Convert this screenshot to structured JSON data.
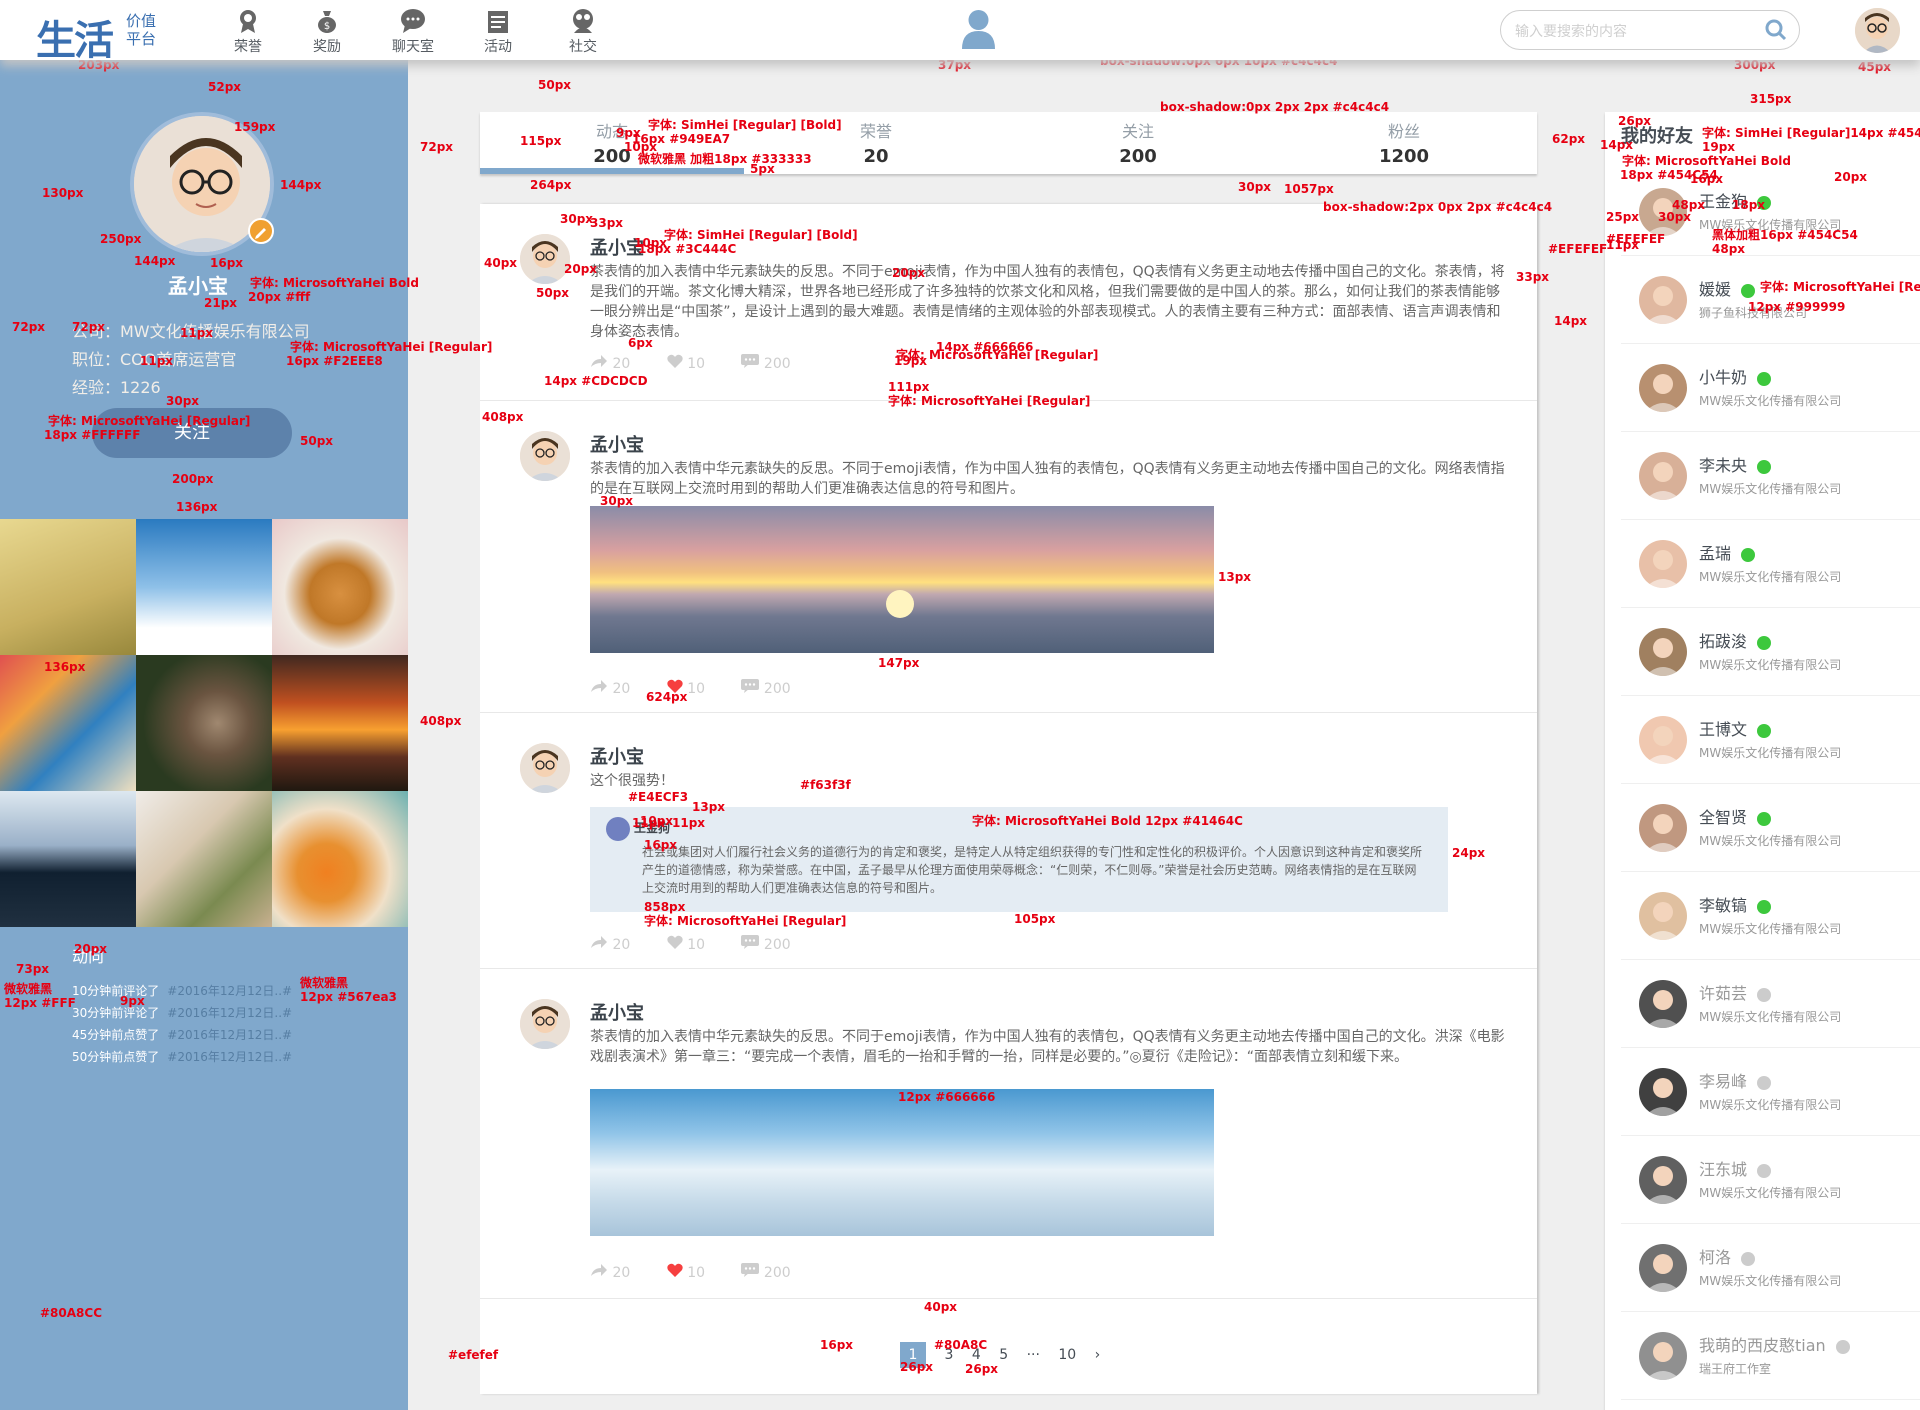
{
  "header": {
    "logo_big": "生活",
    "logo_small_1": "价值",
    "logo_small_2": "平台",
    "nav": [
      {
        "label": "荣誉",
        "icon": "medal-icon"
      },
      {
        "label": "奖励",
        "icon": "money-bag-icon"
      },
      {
        "label": "聊天室",
        "icon": "chat-icon"
      },
      {
        "label": "活动",
        "icon": "calendar-icon"
      },
      {
        "label": "社交",
        "icon": "social-icon"
      }
    ],
    "search_placeholder": "输入要搜索的内容"
  },
  "profile": {
    "name": "孟小宝",
    "company": "公司：MW文化传播娱乐有限公司",
    "position": "职位：COO首席运营官",
    "experience": "经验：1226",
    "follow_label": "关注"
  },
  "dynamics": {
    "title": "动向",
    "items": [
      {
        "text": "10分钟前评论了",
        "date": "#2016年12月12日..#"
      },
      {
        "text": "30分钟前评论了",
        "date": "#2016年12月12日..#"
      },
      {
        "text": "45分钟前点赞了",
        "date": "#2016年12月12日..#"
      },
      {
        "text": "50分钟前点赞了",
        "date": "#2016年12月12日..#"
      }
    ]
  },
  "stats": [
    {
      "label": "动态",
      "value": "200"
    },
    {
      "label": "荣誉",
      "value": "20"
    },
    {
      "label": "关注",
      "value": "200"
    },
    {
      "label": "粉丝",
      "value": "1200"
    }
  ],
  "posts": [
    {
      "name": "孟小宝",
      "text": "茶表情的加入表情中华元素缺失的反思。不同于emoji表情，作为中国人独有的表情包，QQ表情有义务更主动地去传播中国自己的文化。茶表情，将是我们的开端。茶文化博大精深，世界各地已经形成了许多独特的饮茶文化和风格，但我们需要做的是中国人的茶。那么，如何让我们的茶表情能够一眼分辨出是“中国茶”，是设计上遇到的最大难题。表情是情绪的主观体验的外部表现模式。人的表情主要有三种方式：面部表情、语言声调表情和身体姿态表情。",
      "share": "20",
      "like": "10",
      "comment": "200"
    },
    {
      "name": "孟小宝",
      "text": "茶表情的加入表情中华元素缺失的反思。不同于emoji表情，作为中国人独有的表情包，QQ表情有义务更主动地去传播中国自己的文化。网络表情指的是在互联网上交流时用到的帮助人们更准确表达信息的符号和图片。",
      "share": "20",
      "like": "10",
      "comment": "200"
    },
    {
      "name": "孟小宝",
      "text": "这个很强势！",
      "quote_name": "王金狗",
      "quote_text": "社会或集团对人们履行社会义务的道德行为的肯定和褒奖，是特定人从特定组织获得的专门性和定性化的积极评价。个人因意识到这种肯定和褒奖所产生的道德情感，称为荣誉感。在中国，孟子最早从伦理方面使用荣辱概念：“仁则荣，不仁则辱。”荣誉是社会历史范畴。网络表情指的是在互联网上交流时用到的帮助人们更准确表达信息的符号和图片。",
      "share": "20",
      "like": "10",
      "comment": "200"
    },
    {
      "name": "孟小宝",
      "text": "茶表情的加入表情中华元素缺失的反思。不同于emoji表情，作为中国人独有的表情包，QQ表情有义务更主动地去传播中国自己的文化。洪深《电影戏剧表演术》第一章三：“要完成一个表情，眉毛的一抬和手臂的一抬，同样是必要的。”◎夏衍《走险记》：“面部表情立刻和缓下来。",
      "share": "20",
      "like": "10",
      "comment": "200"
    }
  ],
  "pager": {
    "current": "1",
    "items": [
      "3",
      "4",
      "5",
      "···",
      "10"
    ],
    "next": "›"
  },
  "friends": {
    "title": "我的好友",
    "list": [
      {
        "name": "王金狗",
        "company": "MW娱乐文化传播有限公司",
        "online": true
      },
      {
        "name": "媛媛",
        "company": "狮子鱼科技有限公司",
        "online": true
      },
      {
        "name": "小牛奶",
        "company": "MW娱乐文化传播有限公司",
        "online": true
      },
      {
        "name": "李未央",
        "company": "MW娱乐文化传播有限公司",
        "online": true
      },
      {
        "name": "孟瑞",
        "company": "MW娱乐文化传播有限公司",
        "online": true
      },
      {
        "name": "拓跋浚",
        "company": "MW娱乐文化传播有限公司",
        "online": true
      },
      {
        "name": "王博文",
        "company": "MW娱乐文化传播有限公司",
        "online": true
      },
      {
        "name": "全智贤",
        "company": "MW娱乐文化传播有限公司",
        "online": true
      },
      {
        "name": "李敏镐",
        "company": "MW娱乐文化传播有限公司",
        "online": true
      },
      {
        "name": "许茹芸",
        "company": "MW娱乐文化传播有限公司",
        "online": false
      },
      {
        "name": "李易峰",
        "company": "MW娱乐文化传播有限公司",
        "online": false
      },
      {
        "name": "汪东城",
        "company": "MW娱乐文化传播有限公司",
        "online": false
      },
      {
        "name": "柯洛",
        "company": "MW娱乐文化传播有限公司",
        "online": false
      },
      {
        "name": "我萌的西皮憨tian",
        "company": "瑞王府工作室",
        "online": false
      }
    ]
  },
  "annotations": [
    "9px",
    "37px",
    "#E0E0E0",
    "33px",
    "11px",
    "53px",
    "2px",
    "11px",
    "30px",
    "203px",
    "字体: MicrosoftYaHei [Regular]",
    "14px #555B61",
    "#80a8cc",
    "11px",
    "41px",
    "37px",
    "12px",
    "40px",
    "字体: MicrosoftYaHei [Regular]",
    "14px #CFCFCF",
    "45px",
    "24px",
    "53px",
    "300px",
    "45px",
    "box-shadow:0px 6px 10px #c4c4c4",
    "50px",
    "315px",
    "box-shadow:0px 2px 2px #c4c4c4",
    "52px",
    "159px",
    "144px",
    "130px",
    "250px",
    "144px",
    "16px",
    "72px",
    "字体: MicrosoftYaHei Bold",
    "20px #fff",
    "21px",
    "11px",
    "字体: MicrosoftYaHei [Regular]",
    "16px #F2EEE8",
    "11px",
    "72px",
    "30px",
    "字体: MicrosoftYaHei [Regular]",
    "18px #FFFFFF",
    "50px",
    "200px",
    "408px",
    "136px",
    "136px",
    "408px",
    "73px",
    "20px",
    "微软雅黑",
    "12px #FFF",
    "微软雅黑",
    "12px #567ea3",
    "9px",
    "#80A8CC",
    "#efefef",
    "72px",
    "115px",
    "字体: SimHei [Regular] [Bold]",
    "16px #949EA7",
    "微软雅黑 加粗18px #333333",
    "10px",
    "9px",
    "5px",
    "264px",
    "1057px",
    "30px",
    "62px",
    "14px",
    "box-shadow:2px 0px 2px #c4c4c4",
    "33px",
    "#EFEFEF",
    "30px",
    "33px",
    "字体: SimHei [Regular] [Bold]",
    "18px #3C444C",
    "10px",
    "40px",
    "20px",
    "50px",
    "20px",
    "字体: MicrosoftYaHei [Regular]",
    "14px #666666",
    "19px",
    "6px",
    "111px",
    "字体: MicrosoftYaHei [Regular]",
    "14px #CDCDCD",
    "30px",
    "13px",
    "147px",
    "624px",
    "#f63f3f",
    "#E4ECF3",
    "13px",
    "10px",
    "字体: MicrosoftYaHei Bold 12px #41464C",
    "16px",
    "11px",
    "11px",
    "24px",
    "105px",
    "858px",
    "字体: MicrosoftYaHei [Regular]",
    "12px #666666",
    "40px",
    "16px",
    "#80A8C",
    "26px",
    "26px",
    "26px",
    "字体: SimHei [Regular]14px #454C54",
    "19px",
    "字体: MicrosoftYaHei Bold",
    "18px #454C54",
    "16px",
    "20px",
    "25px",
    "#EFEFEF",
    "30px",
    "48px",
    "18px",
    "11px",
    "黑体加粗16px #454C54",
    "48px",
    "字体: MicrosoftYaHei [Regular]",
    "12px #999999",
    "14px",
    "14px",
    "72px"
  ]
}
